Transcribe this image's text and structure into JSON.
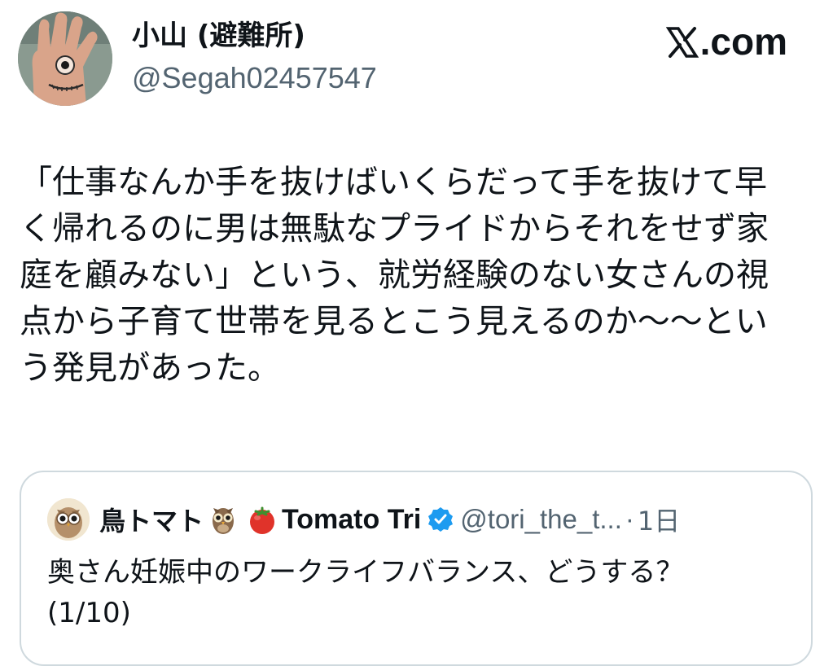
{
  "author": {
    "display_name": "小山 (避難所)",
    "handle": "@Segah02457547",
    "avatar_icon": "hand-eye-avatar-icon"
  },
  "brand": {
    "label": ".com",
    "icon": "x-logo-icon"
  },
  "tweet": {
    "lines": [
      "「仕事なんか手を抜けばいくらだって手を抜けて早",
      "く帰れるのに男は無駄なプライドからそれをせず家",
      "庭を顧みない」という、就労経験のない女さんの視",
      "点から子育て世帯を見るとこう見えるのか〜〜とい",
      "う発見があった。"
    ]
  },
  "quoted_tweet": {
    "display_name": "鳥トマト",
    "display_name_suffix": "Tomato Tri",
    "handle": "@tori_the_t...",
    "separator": "·",
    "time": "1日",
    "avatar_icon": "owl-avatar-icon",
    "emoji_1": "owl-emoji-icon",
    "emoji_2": "tomato-emoji-icon",
    "verified_icon": "verified-badge-icon",
    "body_lines": [
      "奥さん妊娠中のワークライフバランス、どうする？",
      "(1/10)"
    ]
  },
  "colors": {
    "text": "#0f1419",
    "secondary": "#536471",
    "border": "#cfd9de",
    "verified": "#1d9bf0"
  }
}
